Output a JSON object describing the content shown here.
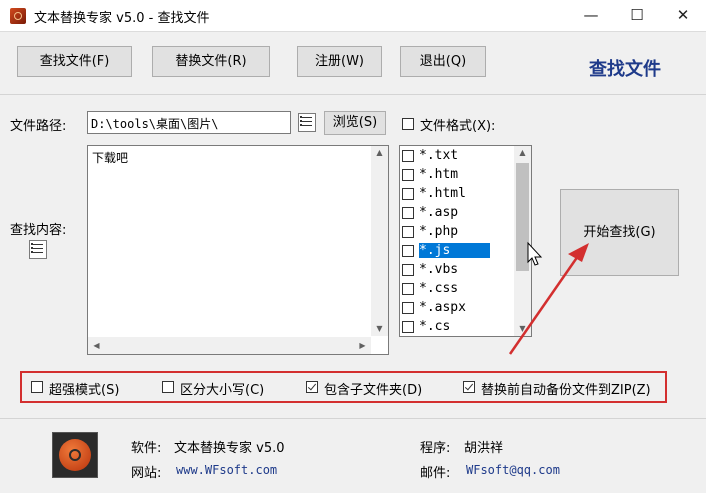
{
  "window": {
    "title": "文本替换专家 v5.0 - 查找文件"
  },
  "window_buttons": {
    "minimize": "—",
    "maximize": "☐",
    "close": "✕"
  },
  "toolbar": {
    "find": "查找文件(F)",
    "replace": "替换文件(R)",
    "register": "注册(W)",
    "exit": "退出(Q)"
  },
  "header": {
    "title": "查找文件"
  },
  "path": {
    "label": "文件路径:",
    "value": "D:\\tools\\桌面\\图片\\",
    "browse": "浏览(S)"
  },
  "format": {
    "label": "文件格式(X):",
    "checked": false,
    "items": [
      "*.txt",
      "*.htm",
      "*.html",
      "*.asp",
      "*.php",
      "*.js",
      "*.vbs",
      "*.css",
      "*.aspx",
      "*.cs"
    ],
    "selected": "*.js"
  },
  "content": {
    "label": "查找内容:",
    "text": "下载吧"
  },
  "start_button": "开始查找(G)",
  "options": [
    {
      "label": "超强模式(S)",
      "checked": false
    },
    {
      "label": "区分大小写(C)",
      "checked": false
    },
    {
      "label": "包含子文件夹(D)",
      "checked": true
    },
    {
      "label": "替换前自动备份文件到ZIP(Z)",
      "checked": true
    }
  ],
  "footer": {
    "software_label": "软件:",
    "software_value": "文本替换专家 v5.0",
    "website_label": "网站:",
    "website_value": "www.WFsoft.com",
    "programmer_label": "程序:",
    "programmer_value": "胡洪祥",
    "email_label": "邮件:",
    "email_value": "WFsoft@qq.com"
  },
  "colors": {
    "highlight_red": "#d32f2f",
    "selection_blue": "#0078d7",
    "title_blue": "#1e3a8a"
  }
}
